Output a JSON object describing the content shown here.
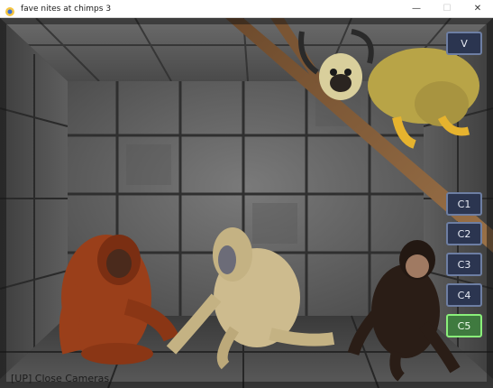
{
  "window": {
    "title": "fave nites at chimps 3",
    "minimize_glyph": "—",
    "maximize_glyph": "☐",
    "close_glyph": "✕"
  },
  "camera_panel": {
    "view_button": "V",
    "cameras": [
      {
        "label": "C1",
        "active": false
      },
      {
        "label": "C2",
        "active": false
      },
      {
        "label": "C3",
        "active": false
      },
      {
        "label": "C4",
        "active": false
      },
      {
        "label": "C5",
        "active": true
      }
    ]
  },
  "hint": {
    "text": "[UP] Close Cameras"
  },
  "scene": {
    "characters": [
      "squirrel-monkey",
      "orangutan",
      "baboon",
      "chimpanzee"
    ]
  },
  "colors": {
    "button_bg": "#2b3550",
    "button_border": "#6d7ea3",
    "active_border": "#8af07a",
    "wall": "#5b5b5b"
  }
}
